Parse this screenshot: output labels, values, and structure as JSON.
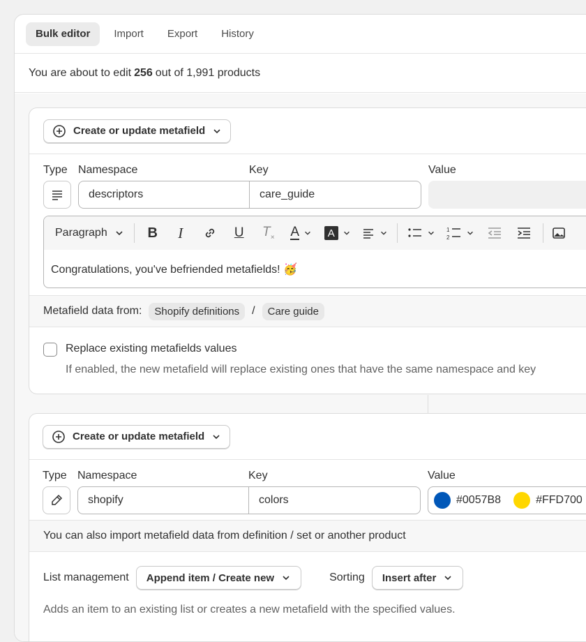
{
  "tabs": [
    "Bulk editor",
    "Import",
    "Export",
    "History"
  ],
  "summary": {
    "prefix": "You are about to edit",
    "count": "256",
    "suffix": "out of 1,991 products"
  },
  "labels": {
    "type": "Type",
    "namespace": "Namespace",
    "key": "Key",
    "value": "Value"
  },
  "action_label": "Create or update metafield",
  "card1": {
    "namespace": "descriptors",
    "key": "care_guide",
    "editor": {
      "paragraph": "Paragraph",
      "content": "Congratulations, you've befriended metafields! 🥳"
    },
    "meta_source_label": "Metafield data from:",
    "chips": [
      "Shopify definitions",
      "Care guide"
    ],
    "chip_sep": "/",
    "replace_label": "Replace existing metafields values",
    "replace_help": "If enabled, the new metafield will replace existing ones that have the same namespace and key"
  },
  "card2": {
    "namespace": "shopify",
    "key": "colors",
    "colors": [
      {
        "hex": "#0057B8"
      },
      {
        "hex": "#FFD700"
      }
    ],
    "import_hint": "You can also import metafield data from definition / set or another product",
    "list_label": "List management",
    "list_value": "Append item / Create new",
    "sorting_label": "Sorting",
    "sorting_value": "Insert after",
    "list_help": "Adds an item to an existing list or creates a new metafield with the specified values."
  },
  "icons": {
    "action": "plus-circle-icon",
    "type_text": "text-lines-icon",
    "type_color": "eyedropper-icon"
  }
}
